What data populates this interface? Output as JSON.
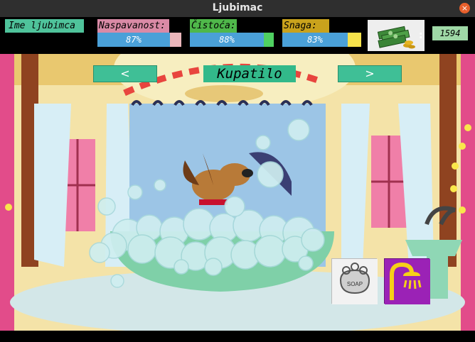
{
  "window": {
    "title": "Ljubimac",
    "close_glyph": "×"
  },
  "hud": {
    "pet_name": "Ime ljubimca",
    "stats": [
      {
        "label": "Naspavanost:",
        "value_text": "87%",
        "value": 87,
        "label_color": "#d98aa6",
        "tab_color": "#eab6bb"
      },
      {
        "label": "Čistoća:",
        "value_text": "88%",
        "value": 88,
        "label_color": "#4fb84a",
        "tab_color": "#4fd061"
      },
      {
        "label": "Snaga:",
        "value_text": "83%",
        "value": 83,
        "label_color": "#c9a21c",
        "tab_color": "#f7e34b"
      }
    ],
    "money_icon": "money-stack-icon",
    "money": "1594"
  },
  "scene": {
    "room": "Kupatilo",
    "prev_glyph": "<",
    "next_glyph": ">",
    "actions": [
      {
        "icon": "soap-icon",
        "text": "SOAP"
      },
      {
        "icon": "shower-icon"
      }
    ]
  }
}
